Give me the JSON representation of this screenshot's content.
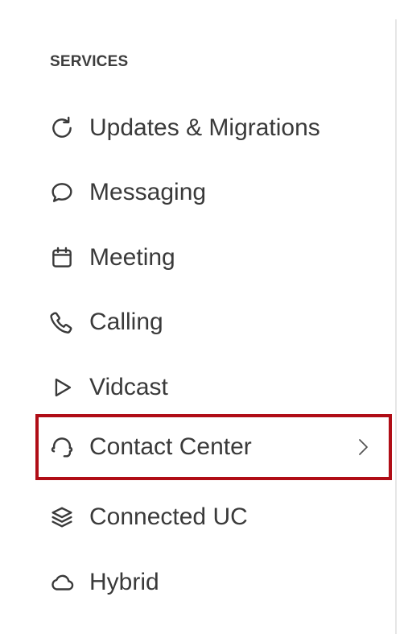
{
  "services": {
    "header": "SERVICES",
    "items": [
      {
        "label": "Updates & Migrations",
        "icon": "refresh-icon"
      },
      {
        "label": "Messaging",
        "icon": "chat-bubble-icon"
      },
      {
        "label": "Meeting",
        "icon": "calendar-icon"
      },
      {
        "label": "Calling",
        "icon": "phone-icon"
      },
      {
        "label": "Vidcast",
        "icon": "play-icon"
      },
      {
        "label": "Contact Center",
        "icon": "headset-icon",
        "has_submenu": true,
        "highlighted": true
      },
      {
        "label": "Connected UC",
        "icon": "layers-icon"
      },
      {
        "label": "Hybrid",
        "icon": "cloud-icon"
      }
    ]
  },
  "colors": {
    "text": "#3a3a3a",
    "highlight_border": "#b00d16",
    "divider": "#e6e6e6"
  }
}
